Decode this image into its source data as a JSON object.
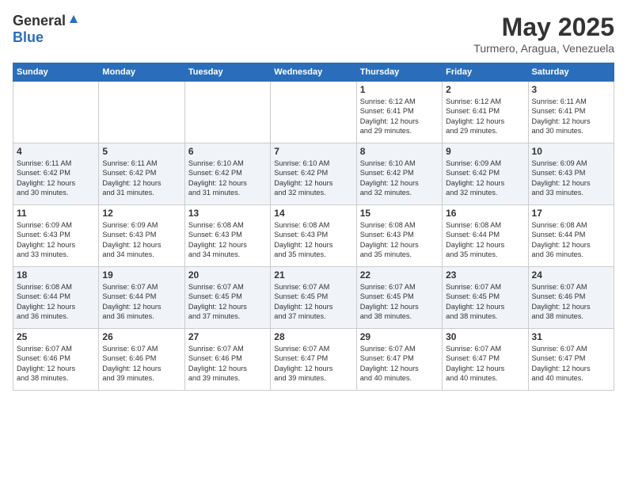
{
  "header": {
    "logo_line1": "General",
    "logo_line2": "Blue",
    "month_year": "May 2025",
    "location": "Turmero, Aragua, Venezuela"
  },
  "weekdays": [
    "Sunday",
    "Monday",
    "Tuesday",
    "Wednesday",
    "Thursday",
    "Friday",
    "Saturday"
  ],
  "weeks": [
    [
      {
        "day": "",
        "info": ""
      },
      {
        "day": "",
        "info": ""
      },
      {
        "day": "",
        "info": ""
      },
      {
        "day": "",
        "info": ""
      },
      {
        "day": "1",
        "info": "Sunrise: 6:12 AM\nSunset: 6:41 PM\nDaylight: 12 hours\nand 29 minutes."
      },
      {
        "day": "2",
        "info": "Sunrise: 6:12 AM\nSunset: 6:41 PM\nDaylight: 12 hours\nand 29 minutes."
      },
      {
        "day": "3",
        "info": "Sunrise: 6:11 AM\nSunset: 6:41 PM\nDaylight: 12 hours\nand 30 minutes."
      }
    ],
    [
      {
        "day": "4",
        "info": "Sunrise: 6:11 AM\nSunset: 6:42 PM\nDaylight: 12 hours\nand 30 minutes."
      },
      {
        "day": "5",
        "info": "Sunrise: 6:11 AM\nSunset: 6:42 PM\nDaylight: 12 hours\nand 31 minutes."
      },
      {
        "day": "6",
        "info": "Sunrise: 6:10 AM\nSunset: 6:42 PM\nDaylight: 12 hours\nand 31 minutes."
      },
      {
        "day": "7",
        "info": "Sunrise: 6:10 AM\nSunset: 6:42 PM\nDaylight: 12 hours\nand 32 minutes."
      },
      {
        "day": "8",
        "info": "Sunrise: 6:10 AM\nSunset: 6:42 PM\nDaylight: 12 hours\nand 32 minutes."
      },
      {
        "day": "9",
        "info": "Sunrise: 6:09 AM\nSunset: 6:42 PM\nDaylight: 12 hours\nand 32 minutes."
      },
      {
        "day": "10",
        "info": "Sunrise: 6:09 AM\nSunset: 6:43 PM\nDaylight: 12 hours\nand 33 minutes."
      }
    ],
    [
      {
        "day": "11",
        "info": "Sunrise: 6:09 AM\nSunset: 6:43 PM\nDaylight: 12 hours\nand 33 minutes."
      },
      {
        "day": "12",
        "info": "Sunrise: 6:09 AM\nSunset: 6:43 PM\nDaylight: 12 hours\nand 34 minutes."
      },
      {
        "day": "13",
        "info": "Sunrise: 6:08 AM\nSunset: 6:43 PM\nDaylight: 12 hours\nand 34 minutes."
      },
      {
        "day": "14",
        "info": "Sunrise: 6:08 AM\nSunset: 6:43 PM\nDaylight: 12 hours\nand 35 minutes."
      },
      {
        "day": "15",
        "info": "Sunrise: 6:08 AM\nSunset: 6:43 PM\nDaylight: 12 hours\nand 35 minutes."
      },
      {
        "day": "16",
        "info": "Sunrise: 6:08 AM\nSunset: 6:44 PM\nDaylight: 12 hours\nand 35 minutes."
      },
      {
        "day": "17",
        "info": "Sunrise: 6:08 AM\nSunset: 6:44 PM\nDaylight: 12 hours\nand 36 minutes."
      }
    ],
    [
      {
        "day": "18",
        "info": "Sunrise: 6:08 AM\nSunset: 6:44 PM\nDaylight: 12 hours\nand 36 minutes."
      },
      {
        "day": "19",
        "info": "Sunrise: 6:07 AM\nSunset: 6:44 PM\nDaylight: 12 hours\nand 36 minutes."
      },
      {
        "day": "20",
        "info": "Sunrise: 6:07 AM\nSunset: 6:45 PM\nDaylight: 12 hours\nand 37 minutes."
      },
      {
        "day": "21",
        "info": "Sunrise: 6:07 AM\nSunset: 6:45 PM\nDaylight: 12 hours\nand 37 minutes."
      },
      {
        "day": "22",
        "info": "Sunrise: 6:07 AM\nSunset: 6:45 PM\nDaylight: 12 hours\nand 38 minutes."
      },
      {
        "day": "23",
        "info": "Sunrise: 6:07 AM\nSunset: 6:45 PM\nDaylight: 12 hours\nand 38 minutes."
      },
      {
        "day": "24",
        "info": "Sunrise: 6:07 AM\nSunset: 6:46 PM\nDaylight: 12 hours\nand 38 minutes."
      }
    ],
    [
      {
        "day": "25",
        "info": "Sunrise: 6:07 AM\nSunset: 6:46 PM\nDaylight: 12 hours\nand 38 minutes."
      },
      {
        "day": "26",
        "info": "Sunrise: 6:07 AM\nSunset: 6:46 PM\nDaylight: 12 hours\nand 39 minutes."
      },
      {
        "day": "27",
        "info": "Sunrise: 6:07 AM\nSunset: 6:46 PM\nDaylight: 12 hours\nand 39 minutes."
      },
      {
        "day": "28",
        "info": "Sunrise: 6:07 AM\nSunset: 6:47 PM\nDaylight: 12 hours\nand 39 minutes."
      },
      {
        "day": "29",
        "info": "Sunrise: 6:07 AM\nSunset: 6:47 PM\nDaylight: 12 hours\nand 40 minutes."
      },
      {
        "day": "30",
        "info": "Sunrise: 6:07 AM\nSunset: 6:47 PM\nDaylight: 12 hours\nand 40 minutes."
      },
      {
        "day": "31",
        "info": "Sunrise: 6:07 AM\nSunset: 6:47 PM\nDaylight: 12 hours\nand 40 minutes."
      }
    ]
  ]
}
